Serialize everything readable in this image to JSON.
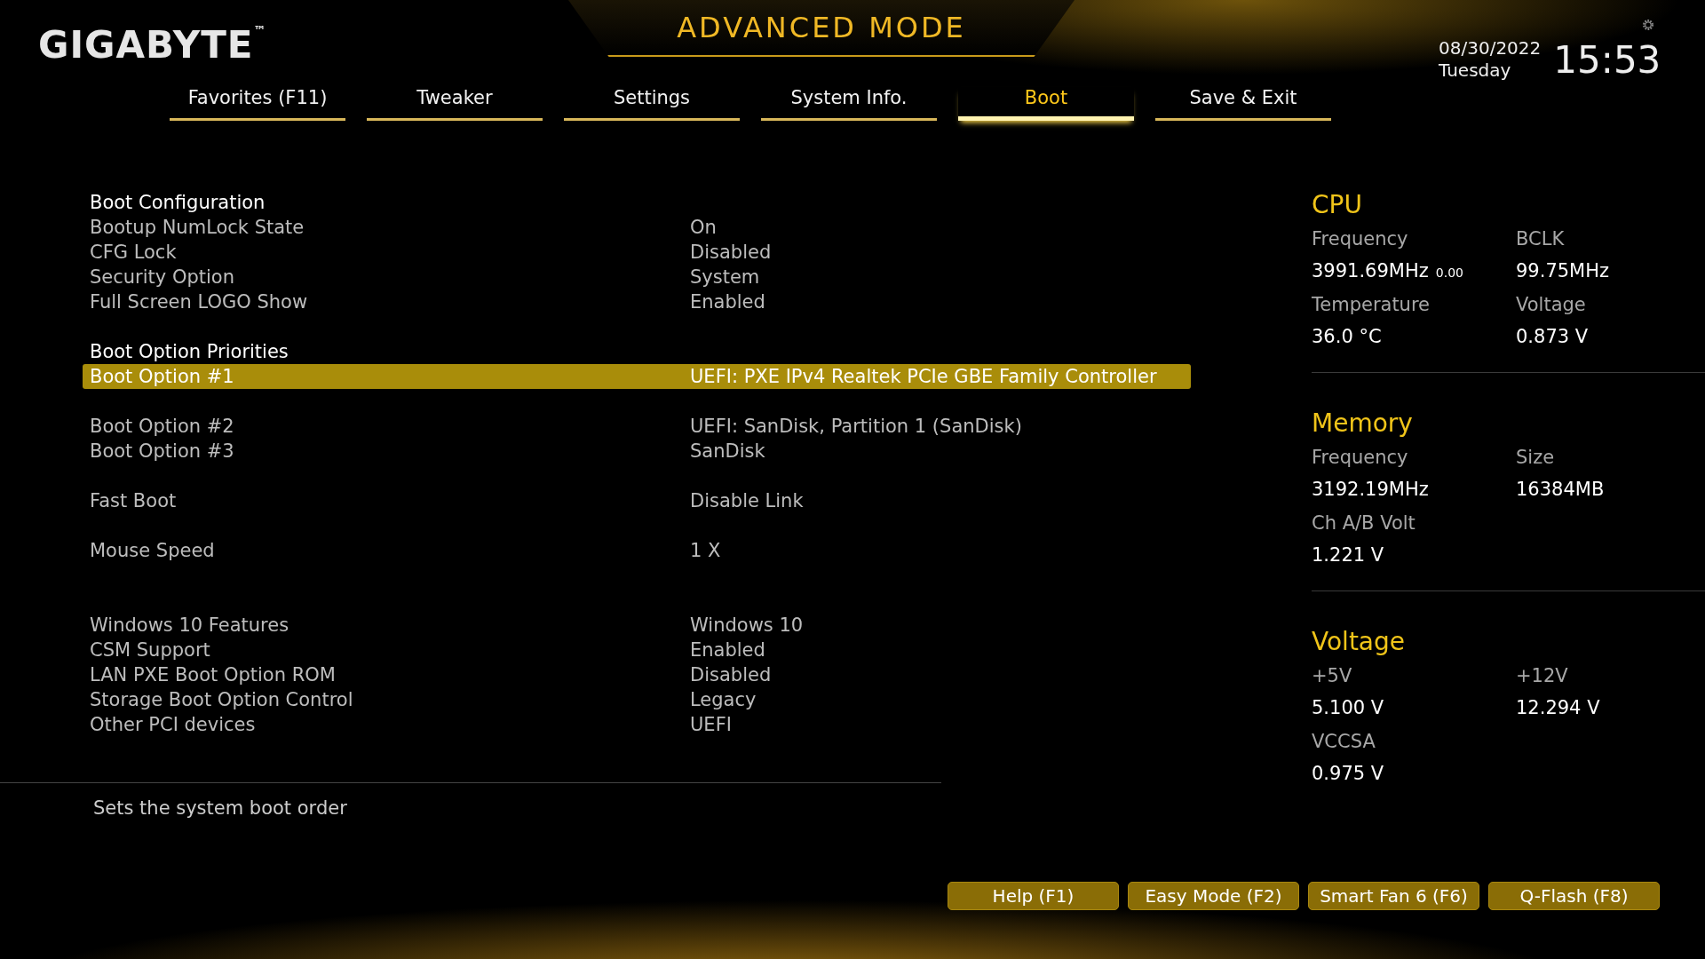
{
  "brand": "GIGABYTE",
  "brand_mark": "™",
  "mode_title": "ADVANCED MODE",
  "date": "08/30/2022",
  "weekday": "Tuesday",
  "time": "15:53",
  "tabs": [
    {
      "label": "Favorites (F11)",
      "selected": false
    },
    {
      "label": "Tweaker",
      "selected": false
    },
    {
      "label": "Settings",
      "selected": false
    },
    {
      "label": "System Info.",
      "selected": false
    },
    {
      "label": "Boot",
      "selected": true
    },
    {
      "label": "Save & Exit",
      "selected": false
    }
  ],
  "setting_groups": [
    {
      "rows": [
        {
          "kind": "heading",
          "label": "Boot Configuration",
          "selected": false
        },
        {
          "kind": "item",
          "label": "Bootup NumLock State",
          "value": "On",
          "selected": false
        },
        {
          "kind": "item",
          "label": "CFG Lock",
          "value": "Disabled",
          "selected": false
        },
        {
          "kind": "item",
          "label": "Security Option",
          "value": "System",
          "selected": false
        },
        {
          "kind": "item",
          "label": "Full Screen LOGO Show",
          "value": "Enabled",
          "selected": false
        }
      ]
    },
    {
      "rows": [
        {
          "kind": "heading",
          "label": "Boot Option Priorities",
          "selected": false
        },
        {
          "kind": "item",
          "label": "Boot Option #1",
          "value": "UEFI: PXE IPv4 Realtek PCIe GBE Family Controller",
          "selected": true
        }
      ]
    },
    {
      "rows": [
        {
          "kind": "item",
          "label": "Boot Option #2",
          "value": "UEFI: SanDisk, Partition 1 (SanDisk)",
          "selected": false
        },
        {
          "kind": "item",
          "label": "Boot Option #3",
          "value": "SanDisk",
          "selected": false
        }
      ]
    },
    {
      "rows": [
        {
          "kind": "item",
          "label": "Fast Boot",
          "value": "Disable Link",
          "selected": false
        }
      ]
    },
    {
      "rows": [
        {
          "kind": "item",
          "label": "Mouse Speed",
          "value": "1 X",
          "selected": false
        }
      ]
    },
    {
      "rows": [
        {
          "kind": "item",
          "label": "Windows 10 Features",
          "value": "Windows 10",
          "selected": false
        },
        {
          "kind": "item",
          "label": "CSM Support",
          "value": "Enabled",
          "selected": false
        },
        {
          "kind": "item",
          "label": "LAN PXE Boot Option ROM",
          "value": "Disabled",
          "selected": false
        },
        {
          "kind": "item",
          "label": "Storage Boot Option Control",
          "value": "Legacy",
          "selected": false
        },
        {
          "kind": "item",
          "label": "Other PCI devices",
          "value": "UEFI",
          "selected": false
        }
      ]
    }
  ],
  "help_text": "Sets the system boot order",
  "monitor": [
    {
      "title": "CPU",
      "items": [
        {
          "label": "Frequency",
          "value": "3991.69MHz",
          "note": "0.00"
        },
        {
          "label": "BCLK",
          "value": "99.75MHz"
        },
        {
          "label": "Temperature",
          "value": "36.0 °C"
        },
        {
          "label": "Voltage",
          "value": "0.873 V"
        }
      ]
    },
    {
      "title": "Memory",
      "items": [
        {
          "label": "Frequency",
          "value": "3192.19MHz"
        },
        {
          "label": "Size",
          "value": "16384MB"
        },
        {
          "label": "Ch A/B Volt",
          "value": "1.221 V"
        }
      ]
    },
    {
      "title": "Voltage",
      "items": [
        {
          "label": "+5V",
          "value": "5.100 V"
        },
        {
          "label": "+12V",
          "value": "12.294 V"
        },
        {
          "label": "VCCSA",
          "value": "0.975 V"
        }
      ]
    }
  ],
  "buttons": [
    "Help (F1)",
    "Easy Mode (F2)",
    "Smart Fan 6 (F6)",
    "Q-Flash (F8)"
  ]
}
